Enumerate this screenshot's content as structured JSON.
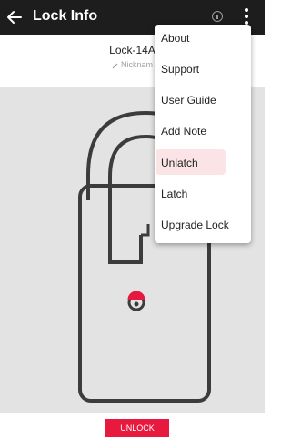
{
  "appbar": {
    "title": "Lock Info",
    "back_icon": "back-arrow-icon",
    "info_icon": "info-icon",
    "menu_icon": "more-vertical-icon"
  },
  "lock": {
    "name": "Lock-14A",
    "nickname_hint": "Nicknam",
    "accent_color": "#e8193f",
    "background_color": "#e3e3e3"
  },
  "menu": {
    "items": [
      {
        "label": "About"
      },
      {
        "label": "Support"
      },
      {
        "label": "User Guide"
      },
      {
        "label": "Add Note"
      },
      {
        "label": "Unlatch",
        "highlighted": true
      },
      {
        "label": "Latch"
      },
      {
        "label": "Upgrade Lock"
      }
    ]
  },
  "actions": {
    "unlock_label": "UNLOCK"
  }
}
